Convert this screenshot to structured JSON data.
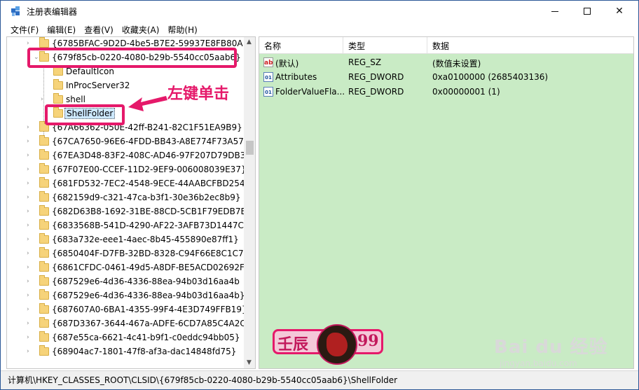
{
  "window": {
    "title": "注册表编辑器",
    "icon": "regedit-icon",
    "controls": {
      "minimize": "minimize-icon",
      "maximize": "maximize-icon",
      "close": "✕"
    }
  },
  "menu": [
    "文件(F)",
    "编辑(E)",
    "查看(V)",
    "收藏夹(A)",
    "帮助(H)"
  ],
  "tree": {
    "rows": [
      {
        "label": "{6785BFAC-9D2D-4be5-B7E2-59937E8FB80A}",
        "expander": "›"
      },
      {
        "label": "{679f85cb-0220-4080-b29b-5540cc05aab6}",
        "expander": "⌄"
      },
      {
        "label": "DefaultIcon",
        "expander": ""
      },
      {
        "label": "InProcServer32",
        "expander": ""
      },
      {
        "label": "shell",
        "expander": "›"
      },
      {
        "label": "ShellFolder",
        "expander": ""
      },
      {
        "label": "{67A66362-050E-42ff-B241-82C1F51EA9B9}",
        "expander": "›"
      },
      {
        "label": "{67CA7650-96E6-4FDD-BB43-A8E774F73A57}",
        "expander": "›"
      },
      {
        "label": "{67EA3D48-83F2-408C-AD46-97F207D79DB3}",
        "expander": "›"
      },
      {
        "label": "{67F07E00-CCEF-11D2-9EF9-006008039E37}",
        "expander": "›"
      },
      {
        "label": "{681FD532-7EC2-4548-9ECE-44AABCFBD254}",
        "expander": "›"
      },
      {
        "label": "{682159d9-c321-47ca-b3f1-30e36b2ec8b9}",
        "expander": "›"
      },
      {
        "label": "{682D63B8-1692-31BE-88CD-5CB1F79EDB7B}",
        "expander": "›"
      },
      {
        "label": "{6833568B-541D-4290-AF22-3AFB73D1447C}",
        "expander": "›"
      },
      {
        "label": "{683a732e-eee1-4aec-8b45-455890e87ff1}",
        "expander": "›"
      },
      {
        "label": "{6850404F-D7FB-32BD-8328-C94F66E8C1C7}",
        "expander": "›"
      },
      {
        "label": "{6861CFDC-0461-49d5-A8DF-BE5ACD02692F}",
        "expander": "›"
      },
      {
        "label": "{687529e6-4d36-4336-88ea-94b03d16aa4b",
        "expander": "›"
      },
      {
        "label": "{687529e6-4d36-4336-88ea-94b03d16aa4b}",
        "expander": "›"
      },
      {
        "label": "{687607A0-6BA1-4355-99F4-4E3D749FFB19}",
        "expander": "›"
      },
      {
        "label": "{687D3367-3644-467a-ADFE-6CD7A85C4A2C}",
        "expander": "›"
      },
      {
        "label": "{687e55ca-6621-4c41-b9f1-c0eddc94bb05}",
        "expander": "›"
      },
      {
        "label": "{68904ac7-1801-47f8-af3a-dac14848fd75}",
        "expander": "›"
      }
    ],
    "selected_index": 5
  },
  "annotation": "左键单击",
  "values": {
    "headers": [
      "名称",
      "类型",
      "数据"
    ],
    "rows": [
      {
        "icon": "ab",
        "name": "(默认)",
        "type": "REG_SZ",
        "data": "(数值未设置)"
      },
      {
        "icon": "bin",
        "name": "Attributes",
        "type": "REG_DWORD",
        "data": "0xa0100000 (2685403136)"
      },
      {
        "icon": "bin",
        "name": "FolderValueFla...",
        "type": "REG_DWORD",
        "data": "0x00000001 (1)"
      }
    ]
  },
  "watermark": {
    "badge_left": "壬辰",
    "badge_right": "99",
    "baidu": "Bai du 经验",
    "baidu_sub": "jingyan.baidu.com"
  },
  "status": {
    "path": "计算机\\HKEY_CLASSES_ROOT\\CLSID\\{679f85cb-0220-4080-b29b-5540cc05aab6}\\ShellFolder"
  },
  "colors": {
    "highlight": "#e5196a",
    "values_bg": "#c9ebc5",
    "selection": "#cce8ff"
  }
}
